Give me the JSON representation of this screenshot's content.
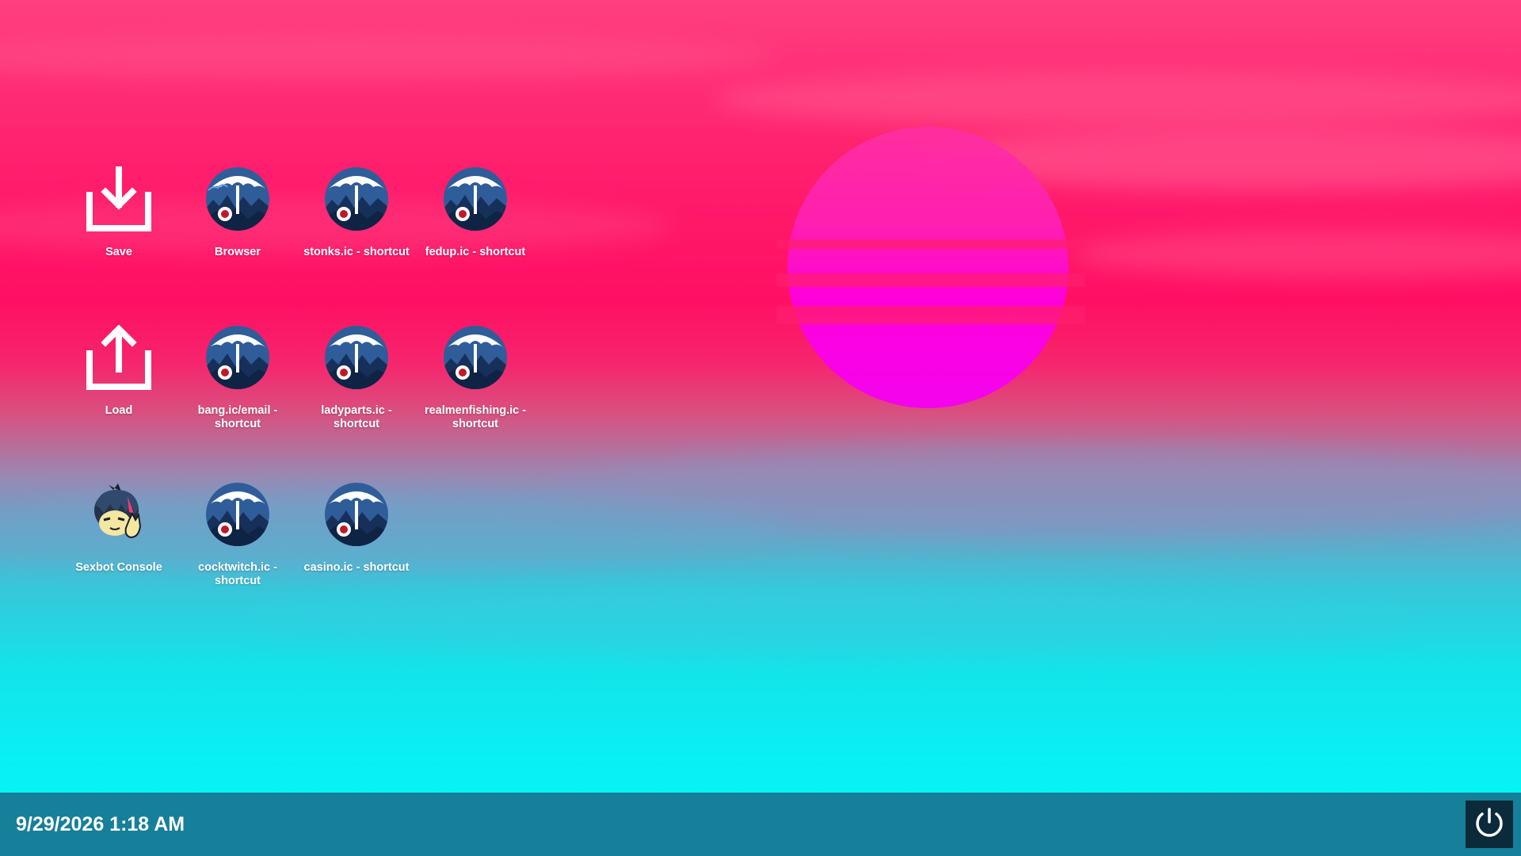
{
  "desktop": {
    "icons": [
      {
        "label": "Save",
        "icon": "download-icon"
      },
      {
        "label": "Browser",
        "icon": "umbrella-browser-icon"
      },
      {
        "label": "stonks.ic - shortcut",
        "icon": "umbrella-browser-icon"
      },
      {
        "label": "fedup.ic - shortcut",
        "icon": "umbrella-browser-icon"
      },
      {
        "label": "Load",
        "icon": "upload-icon"
      },
      {
        "label": "bang.ic/email - shortcut",
        "icon": "umbrella-browser-icon"
      },
      {
        "label": "ladyparts.ic - shortcut",
        "icon": "umbrella-browser-icon"
      },
      {
        "label": "realmenfishing.ic - shortcut",
        "icon": "umbrella-browser-icon"
      },
      {
        "label": "Sexbot Console",
        "icon": "sexbot-avatar-icon"
      },
      {
        "label": "cocktwitch.ic - shortcut",
        "icon": "umbrella-browser-icon"
      },
      {
        "label": "casino.ic - shortcut",
        "icon": "umbrella-browser-icon"
      }
    ]
  },
  "taskbar": {
    "clock": "9/29/2026 1:18 AM",
    "power_icon": "power-icon"
  },
  "colors": {
    "taskbar": "#167f99",
    "power_button": "#0b2a3a",
    "sun": "#ff00e0",
    "sky_top": "#ff3f7f",
    "sky_bottom": "#06f4f6"
  }
}
